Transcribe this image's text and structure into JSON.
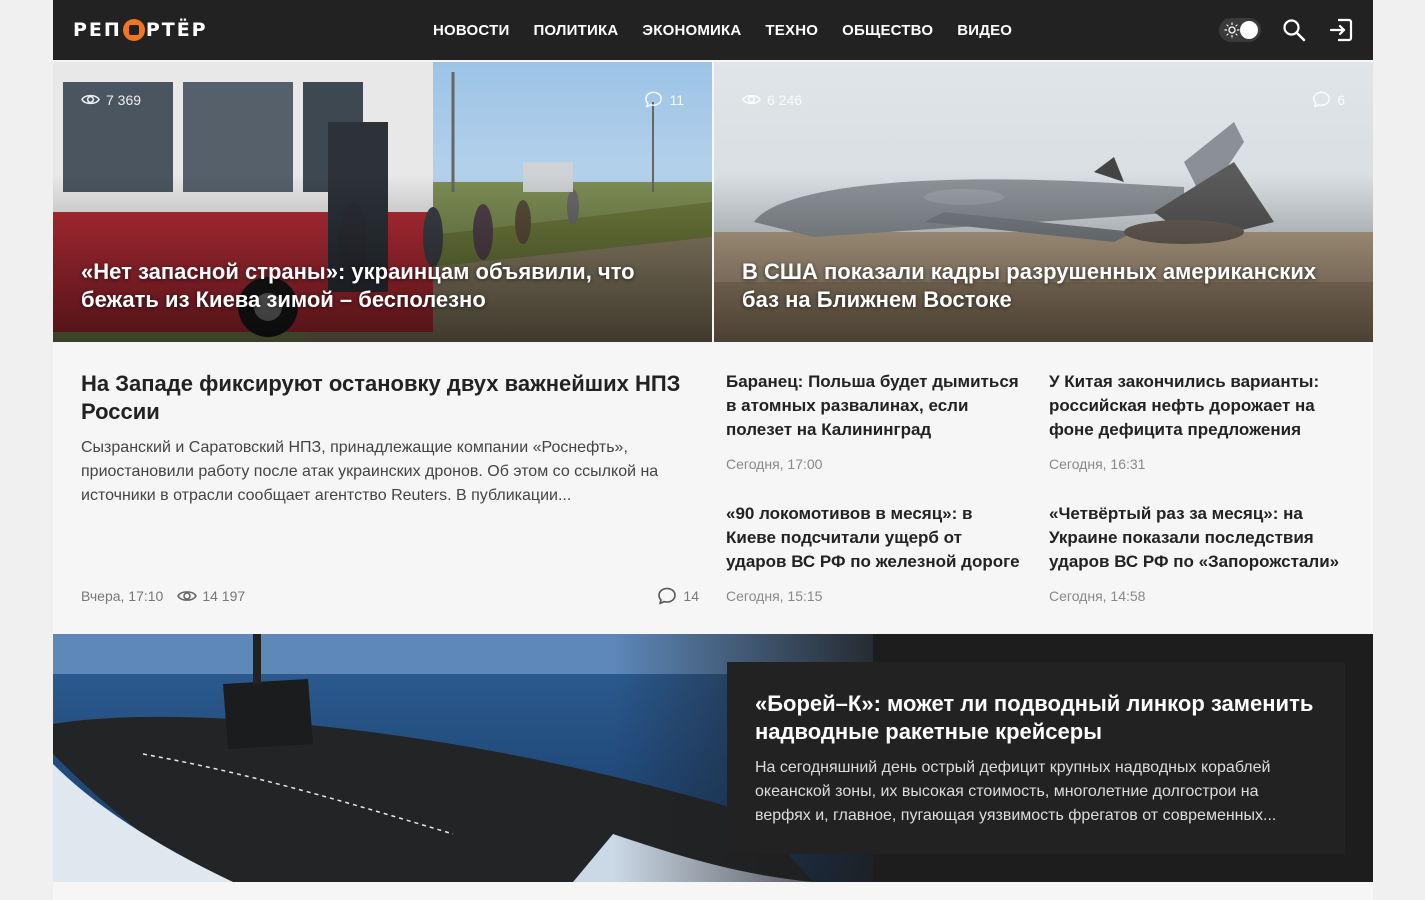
{
  "header": {
    "logo_text": "РЕПОРТЁР",
    "nav": [
      "НОВОСТИ",
      "ПОЛИТИКА",
      "ЭКОНОМИКА",
      "ТЕХНО",
      "ОБЩЕСТВО",
      "ВИДЕО"
    ],
    "icons": [
      "theme-toggle-icon",
      "search-icon",
      "login-icon"
    ]
  },
  "heroes": [
    {
      "views": "7 369",
      "comments": "11",
      "title": "«Нет запасной страны»: украинцам объявили, что бежать из Киева зимой – бесполезно"
    },
    {
      "views": "6 246",
      "comments": "6",
      "title": "В США показали кадры разрушенных американских баз на Ближнем Востоке"
    }
  ],
  "feature": {
    "title": "На Западе фиксируют остановку двух важнейших НПЗ России",
    "text": "Сызранский и Саратовский НПЗ, принадлежащие компании «Роснефть», приостановили работу после атак украинских дронов. Об этом со ссылкой на источники в отрасли сообщает агентство Reuters. В публикации...",
    "date": "Вчера, 17:10",
    "views": "14 197",
    "comments": "14"
  },
  "news": [
    {
      "title": "Баранец: Польша будет дымиться в атомных развалинах, если полезет на Калининград",
      "date": "Сегодня, 17:00"
    },
    {
      "title": "У Китая закончились варианты: российская нефть дорожает на фоне дефицита предложения",
      "date": "Сегодня, 16:31"
    },
    {
      "title": "«90 локомотивов в месяц»: в Киеве подсчитали ущерб от ударов ВС РФ по железной дороге",
      "date": "Сегодня, 15:15"
    },
    {
      "title": "«Четвёртый раз за месяц»: на Украине показали последствия ударов ВС РФ по «Запорожстали»",
      "date": "Сегодня, 14:58"
    }
  ],
  "banner": {
    "title": "«Борей–К»: может ли подводный линкор заменить надводные ракетные крейсеры",
    "text": "На сегодняшний день острый дефицит крупных надводных кораблей океанской зоны, их высокая стоимость, многолетние долгострои на верфях и, главное, пугающая уязвимость фрегатов от современных..."
  },
  "colors": {
    "header_bg": "#222222",
    "accent": "#f07623",
    "page_bg": "#f6f6f6"
  }
}
